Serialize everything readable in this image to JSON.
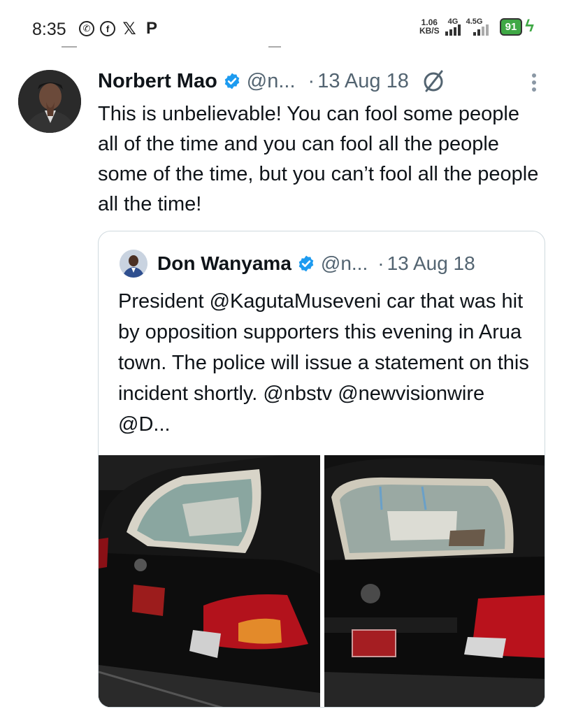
{
  "status_bar": {
    "time": "8:35",
    "left_icons": [
      "whatsapp-icon",
      "facebook-icon",
      "x-icon",
      "p-icon"
    ],
    "data_speed_value": "1.06",
    "data_speed_unit": "KB/S",
    "network_1": "4G",
    "network_2": "4.5G",
    "battery": "91"
  },
  "tweet": {
    "author_name": "Norbert Mao",
    "handle": "@n...",
    "separator": "·",
    "date": "13 Aug 18",
    "text": "This is unbelievable! You can fool some people all of the time and you can fool all the people some of the time, but you can’t fool all the people all the time!"
  },
  "quoted_tweet": {
    "author_name": "Don Wanyama",
    "handle": "@n...",
    "separator": "·",
    "date": "13 Aug 18",
    "text": "President @KagutaMuseveni car that was hit by opposition supporters this evening in Arua town. The police will issue a statement on this incident shortly. @nbstv @newvisionwire @D..."
  },
  "colors": {
    "text_primary": "#0f1419",
    "text_secondary": "#536471",
    "verified_blue": "#1d9bf0",
    "battery_green": "#3fa845",
    "border": "#cfd9de"
  }
}
